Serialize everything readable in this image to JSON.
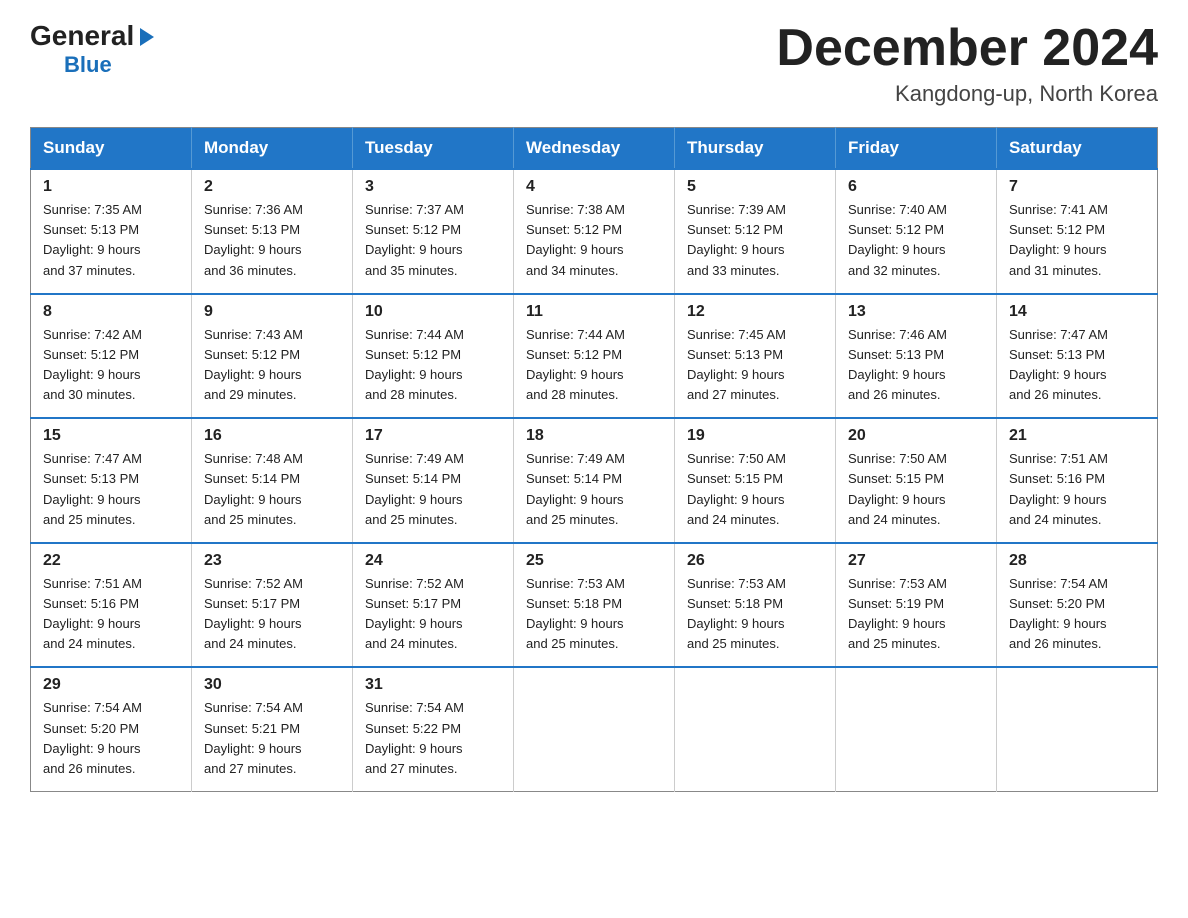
{
  "logo": {
    "general": "General",
    "arrow": "▶",
    "blue": "Blue"
  },
  "title": "December 2024",
  "location": "Kangdong-up, North Korea",
  "days_header": [
    "Sunday",
    "Monday",
    "Tuesday",
    "Wednesday",
    "Thursday",
    "Friday",
    "Saturday"
  ],
  "weeks": [
    [
      {
        "num": "1",
        "sunrise": "7:35 AM",
        "sunset": "5:13 PM",
        "daylight": "9 hours and 37 minutes."
      },
      {
        "num": "2",
        "sunrise": "7:36 AM",
        "sunset": "5:13 PM",
        "daylight": "9 hours and 36 minutes."
      },
      {
        "num": "3",
        "sunrise": "7:37 AM",
        "sunset": "5:12 PM",
        "daylight": "9 hours and 35 minutes."
      },
      {
        "num": "4",
        "sunrise": "7:38 AM",
        "sunset": "5:12 PM",
        "daylight": "9 hours and 34 minutes."
      },
      {
        "num": "5",
        "sunrise": "7:39 AM",
        "sunset": "5:12 PM",
        "daylight": "9 hours and 33 minutes."
      },
      {
        "num": "6",
        "sunrise": "7:40 AM",
        "sunset": "5:12 PM",
        "daylight": "9 hours and 32 minutes."
      },
      {
        "num": "7",
        "sunrise": "7:41 AM",
        "sunset": "5:12 PM",
        "daylight": "9 hours and 31 minutes."
      }
    ],
    [
      {
        "num": "8",
        "sunrise": "7:42 AM",
        "sunset": "5:12 PM",
        "daylight": "9 hours and 30 minutes."
      },
      {
        "num": "9",
        "sunrise": "7:43 AM",
        "sunset": "5:12 PM",
        "daylight": "9 hours and 29 minutes."
      },
      {
        "num": "10",
        "sunrise": "7:44 AM",
        "sunset": "5:12 PM",
        "daylight": "9 hours and 28 minutes."
      },
      {
        "num": "11",
        "sunrise": "7:44 AM",
        "sunset": "5:12 PM",
        "daylight": "9 hours and 28 minutes."
      },
      {
        "num": "12",
        "sunrise": "7:45 AM",
        "sunset": "5:13 PM",
        "daylight": "9 hours and 27 minutes."
      },
      {
        "num": "13",
        "sunrise": "7:46 AM",
        "sunset": "5:13 PM",
        "daylight": "9 hours and 26 minutes."
      },
      {
        "num": "14",
        "sunrise": "7:47 AM",
        "sunset": "5:13 PM",
        "daylight": "9 hours and 26 minutes."
      }
    ],
    [
      {
        "num": "15",
        "sunrise": "7:47 AM",
        "sunset": "5:13 PM",
        "daylight": "9 hours and 25 minutes."
      },
      {
        "num": "16",
        "sunrise": "7:48 AM",
        "sunset": "5:14 PM",
        "daylight": "9 hours and 25 minutes."
      },
      {
        "num": "17",
        "sunrise": "7:49 AM",
        "sunset": "5:14 PM",
        "daylight": "9 hours and 25 minutes."
      },
      {
        "num": "18",
        "sunrise": "7:49 AM",
        "sunset": "5:14 PM",
        "daylight": "9 hours and 25 minutes."
      },
      {
        "num": "19",
        "sunrise": "7:50 AM",
        "sunset": "5:15 PM",
        "daylight": "9 hours and 24 minutes."
      },
      {
        "num": "20",
        "sunrise": "7:50 AM",
        "sunset": "5:15 PM",
        "daylight": "9 hours and 24 minutes."
      },
      {
        "num": "21",
        "sunrise": "7:51 AM",
        "sunset": "5:16 PM",
        "daylight": "9 hours and 24 minutes."
      }
    ],
    [
      {
        "num": "22",
        "sunrise": "7:51 AM",
        "sunset": "5:16 PM",
        "daylight": "9 hours and 24 minutes."
      },
      {
        "num": "23",
        "sunrise": "7:52 AM",
        "sunset": "5:17 PM",
        "daylight": "9 hours and 24 minutes."
      },
      {
        "num": "24",
        "sunrise": "7:52 AM",
        "sunset": "5:17 PM",
        "daylight": "9 hours and 24 minutes."
      },
      {
        "num": "25",
        "sunrise": "7:53 AM",
        "sunset": "5:18 PM",
        "daylight": "9 hours and 25 minutes."
      },
      {
        "num": "26",
        "sunrise": "7:53 AM",
        "sunset": "5:18 PM",
        "daylight": "9 hours and 25 minutes."
      },
      {
        "num": "27",
        "sunrise": "7:53 AM",
        "sunset": "5:19 PM",
        "daylight": "9 hours and 25 minutes."
      },
      {
        "num": "28",
        "sunrise": "7:54 AM",
        "sunset": "5:20 PM",
        "daylight": "9 hours and 26 minutes."
      }
    ],
    [
      {
        "num": "29",
        "sunrise": "7:54 AM",
        "sunset": "5:20 PM",
        "daylight": "9 hours and 26 minutes."
      },
      {
        "num": "30",
        "sunrise": "7:54 AM",
        "sunset": "5:21 PM",
        "daylight": "9 hours and 27 minutes."
      },
      {
        "num": "31",
        "sunrise": "7:54 AM",
        "sunset": "5:22 PM",
        "daylight": "9 hours and 27 minutes."
      },
      null,
      null,
      null,
      null
    ]
  ],
  "labels": {
    "sunrise": "Sunrise:",
    "sunset": "Sunset:",
    "daylight": "Daylight:"
  }
}
